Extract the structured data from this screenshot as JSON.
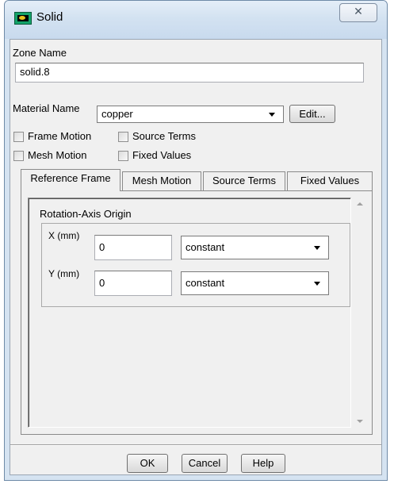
{
  "window": {
    "title": "Solid",
    "close_glyph": "✕"
  },
  "zone": {
    "label": "Zone Name",
    "value": "solid.8"
  },
  "material": {
    "label": "Material Name",
    "selected": "copper",
    "edit_label": "Edit..."
  },
  "options": {
    "frame_motion": "Frame Motion",
    "source_terms": "Source Terms",
    "mesh_motion": "Mesh Motion",
    "fixed_values": "Fixed Values"
  },
  "tabs": [
    {
      "label": "Reference Frame",
      "active": true
    },
    {
      "label": "Mesh Motion",
      "active": false
    },
    {
      "label": "Source Terms",
      "active": false
    },
    {
      "label": "Fixed Values",
      "active": false
    }
  ],
  "rotation_axis": {
    "group_label": "Rotation-Axis Origin",
    "x": {
      "label": "X (mm)",
      "value": "0",
      "method": "constant"
    },
    "y": {
      "label": "Y (mm)",
      "value": "0",
      "method": "constant"
    }
  },
  "footer": {
    "ok": "OK",
    "cancel": "Cancel",
    "help": "Help"
  }
}
